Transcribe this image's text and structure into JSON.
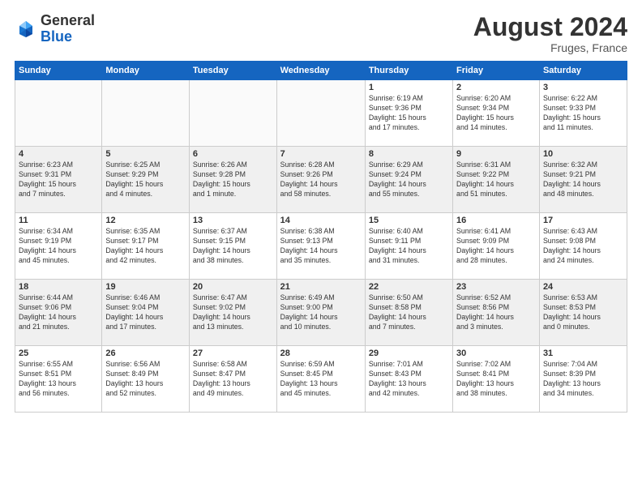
{
  "logo": {
    "general": "General",
    "blue": "Blue"
  },
  "title": "August 2024",
  "location": "Fruges, France",
  "headers": [
    "Sunday",
    "Monday",
    "Tuesday",
    "Wednesday",
    "Thursday",
    "Friday",
    "Saturday"
  ],
  "weeks": [
    [
      {
        "day": "",
        "info": ""
      },
      {
        "day": "",
        "info": ""
      },
      {
        "day": "",
        "info": ""
      },
      {
        "day": "",
        "info": ""
      },
      {
        "day": "1",
        "info": "Sunrise: 6:19 AM\nSunset: 9:36 PM\nDaylight: 15 hours\nand 17 minutes."
      },
      {
        "day": "2",
        "info": "Sunrise: 6:20 AM\nSunset: 9:34 PM\nDaylight: 15 hours\nand 14 minutes."
      },
      {
        "day": "3",
        "info": "Sunrise: 6:22 AM\nSunset: 9:33 PM\nDaylight: 15 hours\nand 11 minutes."
      }
    ],
    [
      {
        "day": "4",
        "info": "Sunrise: 6:23 AM\nSunset: 9:31 PM\nDaylight: 15 hours\nand 7 minutes."
      },
      {
        "day": "5",
        "info": "Sunrise: 6:25 AM\nSunset: 9:29 PM\nDaylight: 15 hours\nand 4 minutes."
      },
      {
        "day": "6",
        "info": "Sunrise: 6:26 AM\nSunset: 9:28 PM\nDaylight: 15 hours\nand 1 minute."
      },
      {
        "day": "7",
        "info": "Sunrise: 6:28 AM\nSunset: 9:26 PM\nDaylight: 14 hours\nand 58 minutes."
      },
      {
        "day": "8",
        "info": "Sunrise: 6:29 AM\nSunset: 9:24 PM\nDaylight: 14 hours\nand 55 minutes."
      },
      {
        "day": "9",
        "info": "Sunrise: 6:31 AM\nSunset: 9:22 PM\nDaylight: 14 hours\nand 51 minutes."
      },
      {
        "day": "10",
        "info": "Sunrise: 6:32 AM\nSunset: 9:21 PM\nDaylight: 14 hours\nand 48 minutes."
      }
    ],
    [
      {
        "day": "11",
        "info": "Sunrise: 6:34 AM\nSunset: 9:19 PM\nDaylight: 14 hours\nand 45 minutes."
      },
      {
        "day": "12",
        "info": "Sunrise: 6:35 AM\nSunset: 9:17 PM\nDaylight: 14 hours\nand 42 minutes."
      },
      {
        "day": "13",
        "info": "Sunrise: 6:37 AM\nSunset: 9:15 PM\nDaylight: 14 hours\nand 38 minutes."
      },
      {
        "day": "14",
        "info": "Sunrise: 6:38 AM\nSunset: 9:13 PM\nDaylight: 14 hours\nand 35 minutes."
      },
      {
        "day": "15",
        "info": "Sunrise: 6:40 AM\nSunset: 9:11 PM\nDaylight: 14 hours\nand 31 minutes."
      },
      {
        "day": "16",
        "info": "Sunrise: 6:41 AM\nSunset: 9:09 PM\nDaylight: 14 hours\nand 28 minutes."
      },
      {
        "day": "17",
        "info": "Sunrise: 6:43 AM\nSunset: 9:08 PM\nDaylight: 14 hours\nand 24 minutes."
      }
    ],
    [
      {
        "day": "18",
        "info": "Sunrise: 6:44 AM\nSunset: 9:06 PM\nDaylight: 14 hours\nand 21 minutes."
      },
      {
        "day": "19",
        "info": "Sunrise: 6:46 AM\nSunset: 9:04 PM\nDaylight: 14 hours\nand 17 minutes."
      },
      {
        "day": "20",
        "info": "Sunrise: 6:47 AM\nSunset: 9:02 PM\nDaylight: 14 hours\nand 13 minutes."
      },
      {
        "day": "21",
        "info": "Sunrise: 6:49 AM\nSunset: 9:00 PM\nDaylight: 14 hours\nand 10 minutes."
      },
      {
        "day": "22",
        "info": "Sunrise: 6:50 AM\nSunset: 8:58 PM\nDaylight: 14 hours\nand 7 minutes."
      },
      {
        "day": "23",
        "info": "Sunrise: 6:52 AM\nSunset: 8:56 PM\nDaylight: 14 hours\nand 3 minutes."
      },
      {
        "day": "24",
        "info": "Sunrise: 6:53 AM\nSunset: 8:53 PM\nDaylight: 14 hours\nand 0 minutes."
      }
    ],
    [
      {
        "day": "25",
        "info": "Sunrise: 6:55 AM\nSunset: 8:51 PM\nDaylight: 13 hours\nand 56 minutes."
      },
      {
        "day": "26",
        "info": "Sunrise: 6:56 AM\nSunset: 8:49 PM\nDaylight: 13 hours\nand 52 minutes."
      },
      {
        "day": "27",
        "info": "Sunrise: 6:58 AM\nSunset: 8:47 PM\nDaylight: 13 hours\nand 49 minutes."
      },
      {
        "day": "28",
        "info": "Sunrise: 6:59 AM\nSunset: 8:45 PM\nDaylight: 13 hours\nand 45 minutes."
      },
      {
        "day": "29",
        "info": "Sunrise: 7:01 AM\nSunset: 8:43 PM\nDaylight: 13 hours\nand 42 minutes."
      },
      {
        "day": "30",
        "info": "Sunrise: 7:02 AM\nSunset: 8:41 PM\nDaylight: 13 hours\nand 38 minutes."
      },
      {
        "day": "31",
        "info": "Sunrise: 7:04 AM\nSunset: 8:39 PM\nDaylight: 13 hours\nand 34 minutes."
      }
    ]
  ]
}
